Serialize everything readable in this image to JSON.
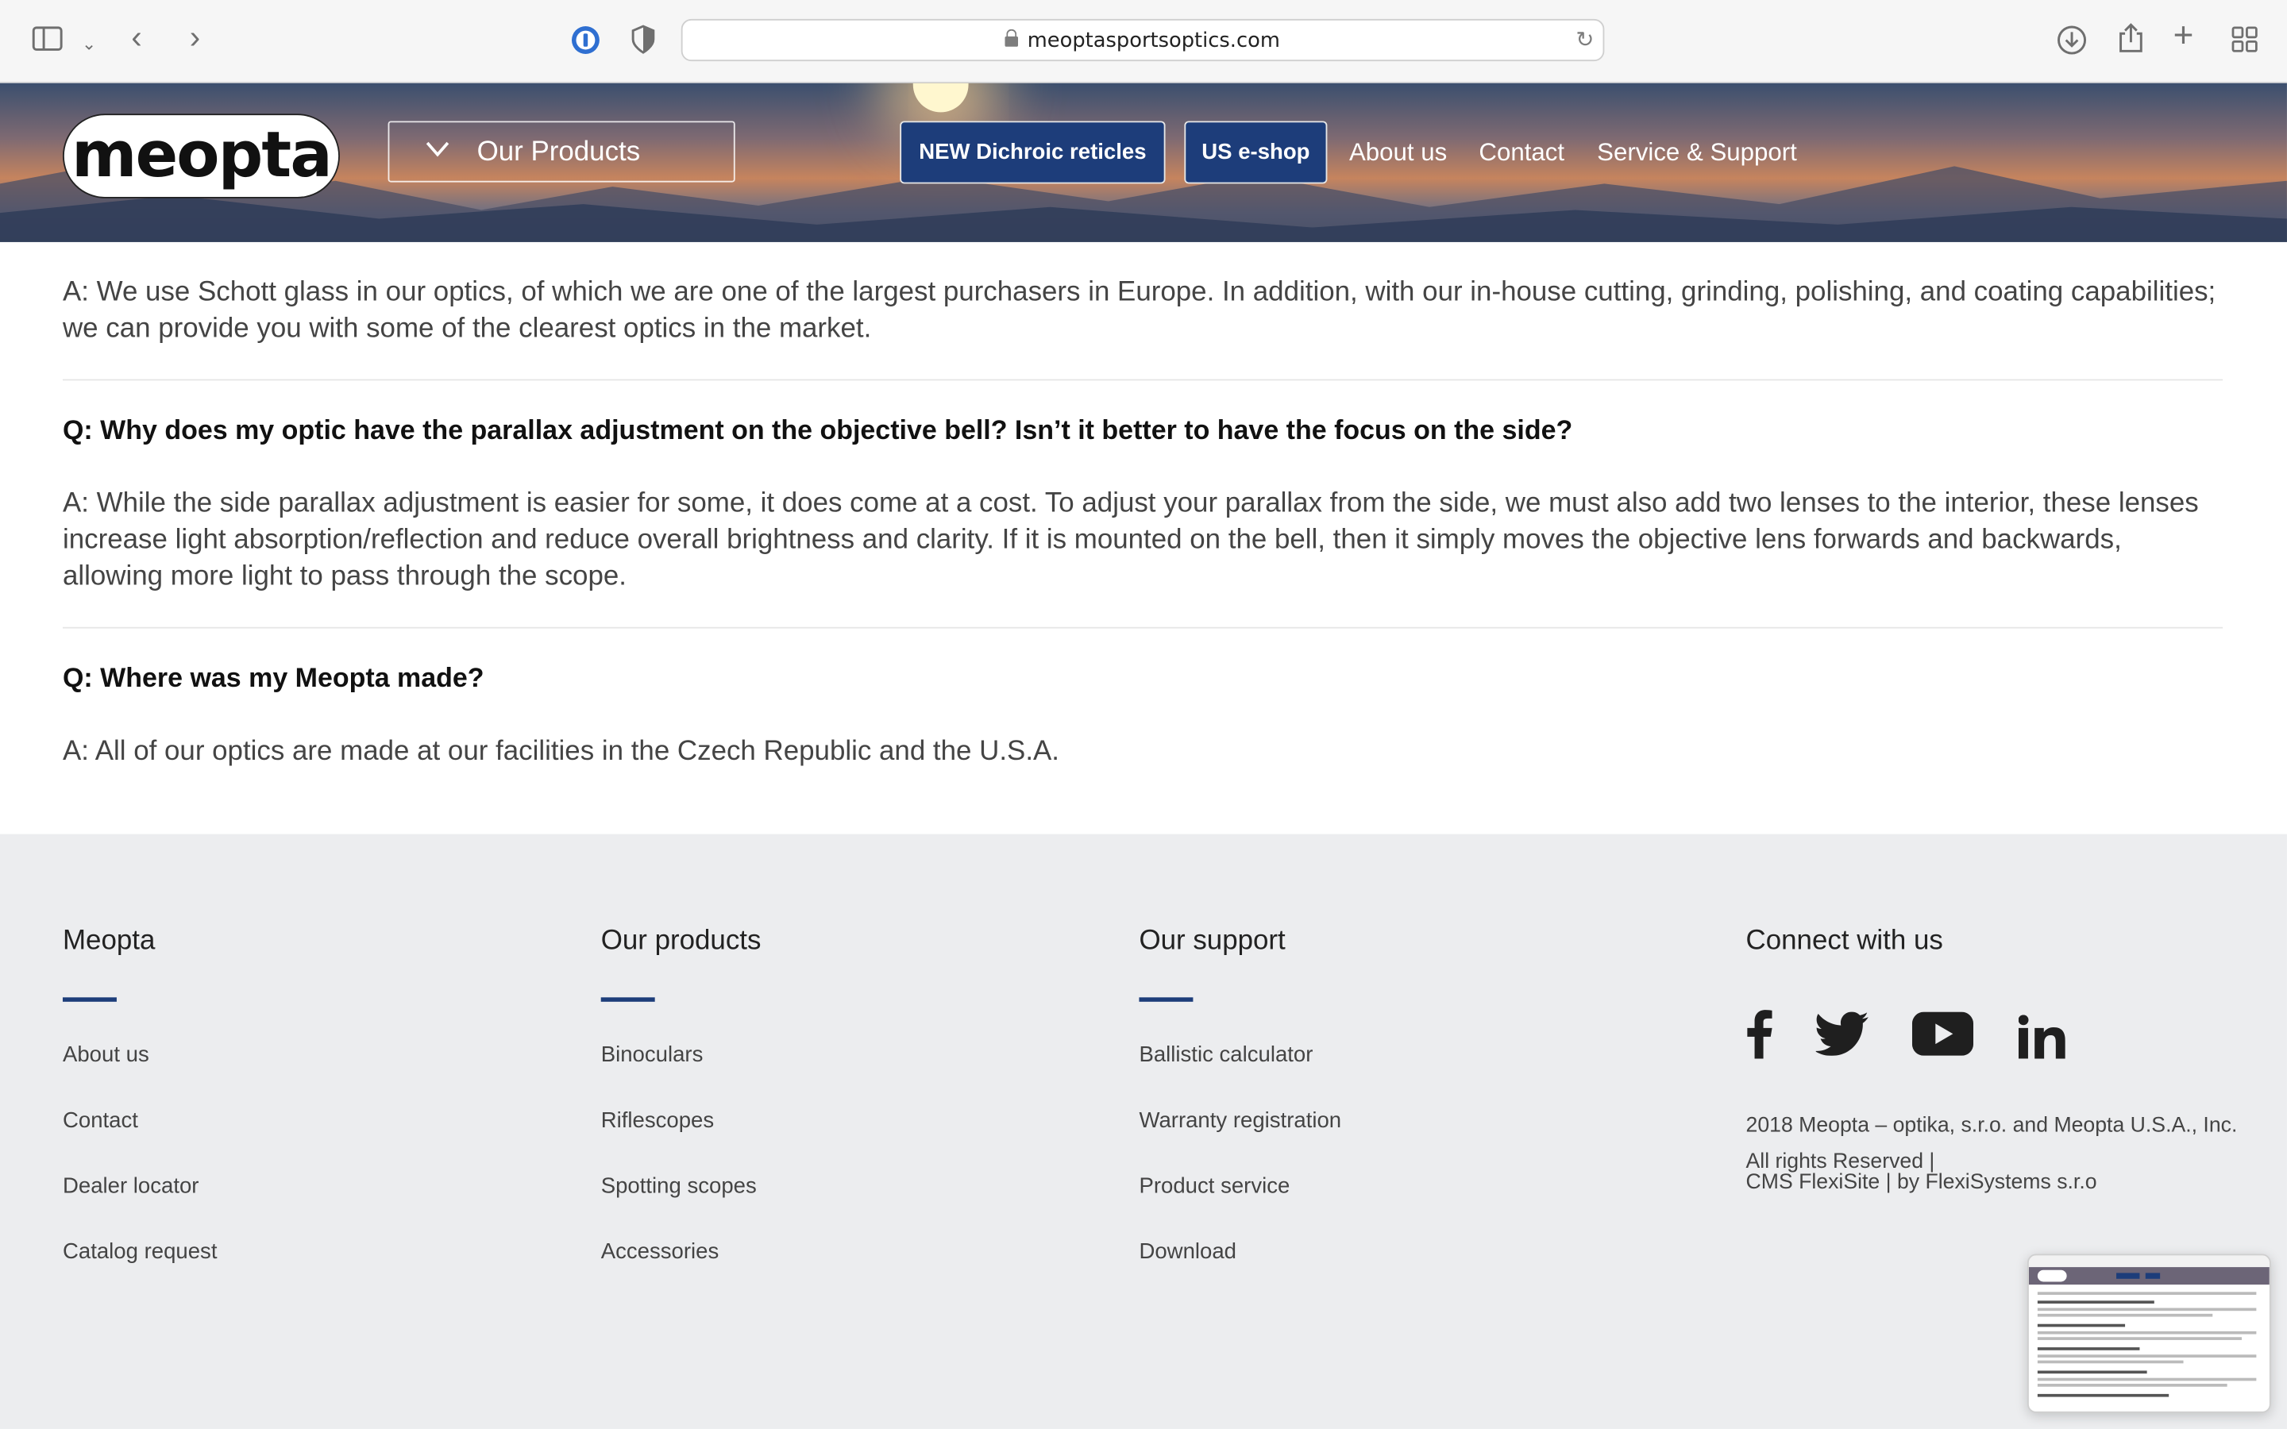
{
  "browser": {
    "url": "meoptasportsoptics.com"
  },
  "header": {
    "logo_text": "meopta",
    "products_label": "Our Products",
    "buttons": [
      "NEW Dichroic reticles",
      "US e-shop"
    ],
    "nav": [
      "About us",
      "Contact",
      "Service & Support"
    ]
  },
  "faq": {
    "answer_top": "A: We use Schott glass in our optics, of which we are one of the largest purchasers in Europe. In addition, with our in-house cutting, grinding, polishing, and coating capabilities; we can provide you with some of the clearest optics in the market.",
    "items": [
      {
        "q": "Q: Why does my optic have the parallax adjustment on the objective bell? Isn’t it better to have the focus on the side?",
        "a": "A: While the side parallax adjustment is easier for some, it does come at a cost. To adjust your parallax from the side, we must also add two lenses to the interior, these lenses increase light absorption/reflection and reduce overall brightness and clarity. If it is mounted on the bell, then it simply moves the objective lens forwards and backwards, allowing more light to pass through the scope."
      },
      {
        "q": "Q: Where was my Meopta made?",
        "a": "A: All of our optics are made at our facilities in the Czech Republic and the U.S.A."
      }
    ]
  },
  "footer": {
    "accent_color": "#1d3d7a",
    "columns": [
      {
        "title": "Meopta",
        "links": [
          "About us",
          "Contact",
          "Dealer locator",
          "Catalog request"
        ]
      },
      {
        "title": "Our products",
        "links": [
          "Binoculars",
          "Riflescopes",
          "Spotting scopes",
          "Accessories"
        ]
      },
      {
        "title": "Our support",
        "links": [
          "Ballistic calculator",
          "Warranty registration",
          "Product service",
          "Download"
        ]
      }
    ],
    "connect": {
      "title": "Connect with us",
      "social": [
        "facebook-icon",
        "twitter-icon",
        "youtube-icon",
        "linkedin-icon"
      ],
      "copyright": "2018 Meopta – optika, s.r.o. and Meopta U.S.A., Inc.",
      "rights": "All rights Reserved |",
      "cms": "CMS FlexiSite | by FlexiSystems s.r.o"
    }
  }
}
